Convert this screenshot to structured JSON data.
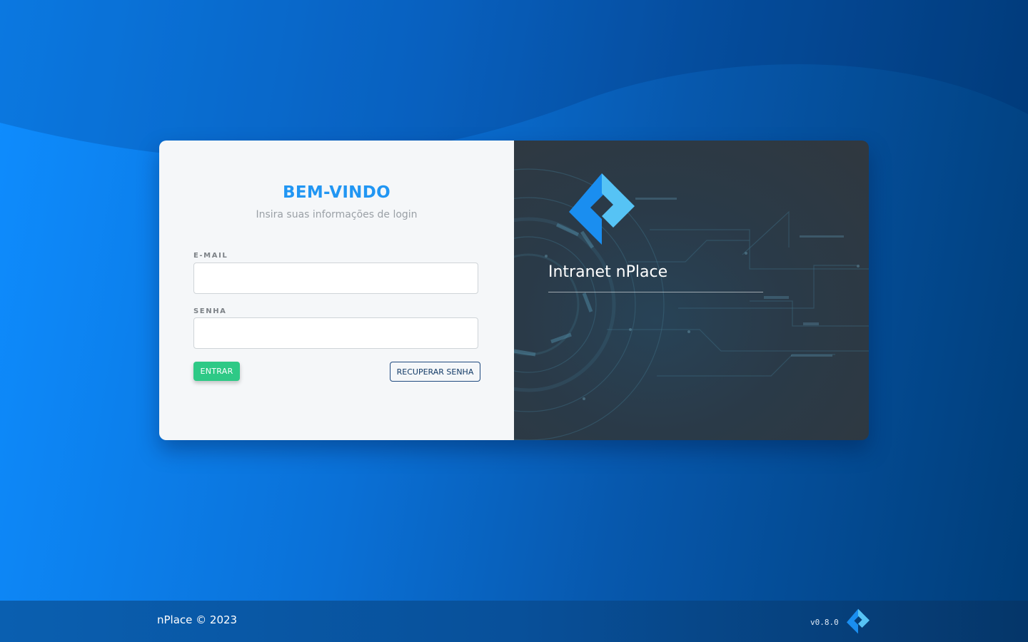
{
  "login": {
    "title": "BEM-VINDO",
    "subtitle": "Insira suas informações de login",
    "email_label": "E-MAIL",
    "email_value": "",
    "email_placeholder": "",
    "password_label": "SENHA",
    "password_value": "",
    "password_placeholder": "",
    "enter_button": "ENTRAR",
    "recover_button": "RECUPERAR SENHA"
  },
  "brand_panel": {
    "logo_icon": "nplace-logo-icon",
    "title": "Intranet nPlace"
  },
  "footer": {
    "copyright": "nPlace © 2023",
    "version": "v0.8.0",
    "logo_icon": "nplace-logo-icon"
  },
  "colors": {
    "accent_blue": "#2196f3",
    "success_green": "#2ec986",
    "navy": "#123a66",
    "background_blue": "#0a70d6"
  }
}
